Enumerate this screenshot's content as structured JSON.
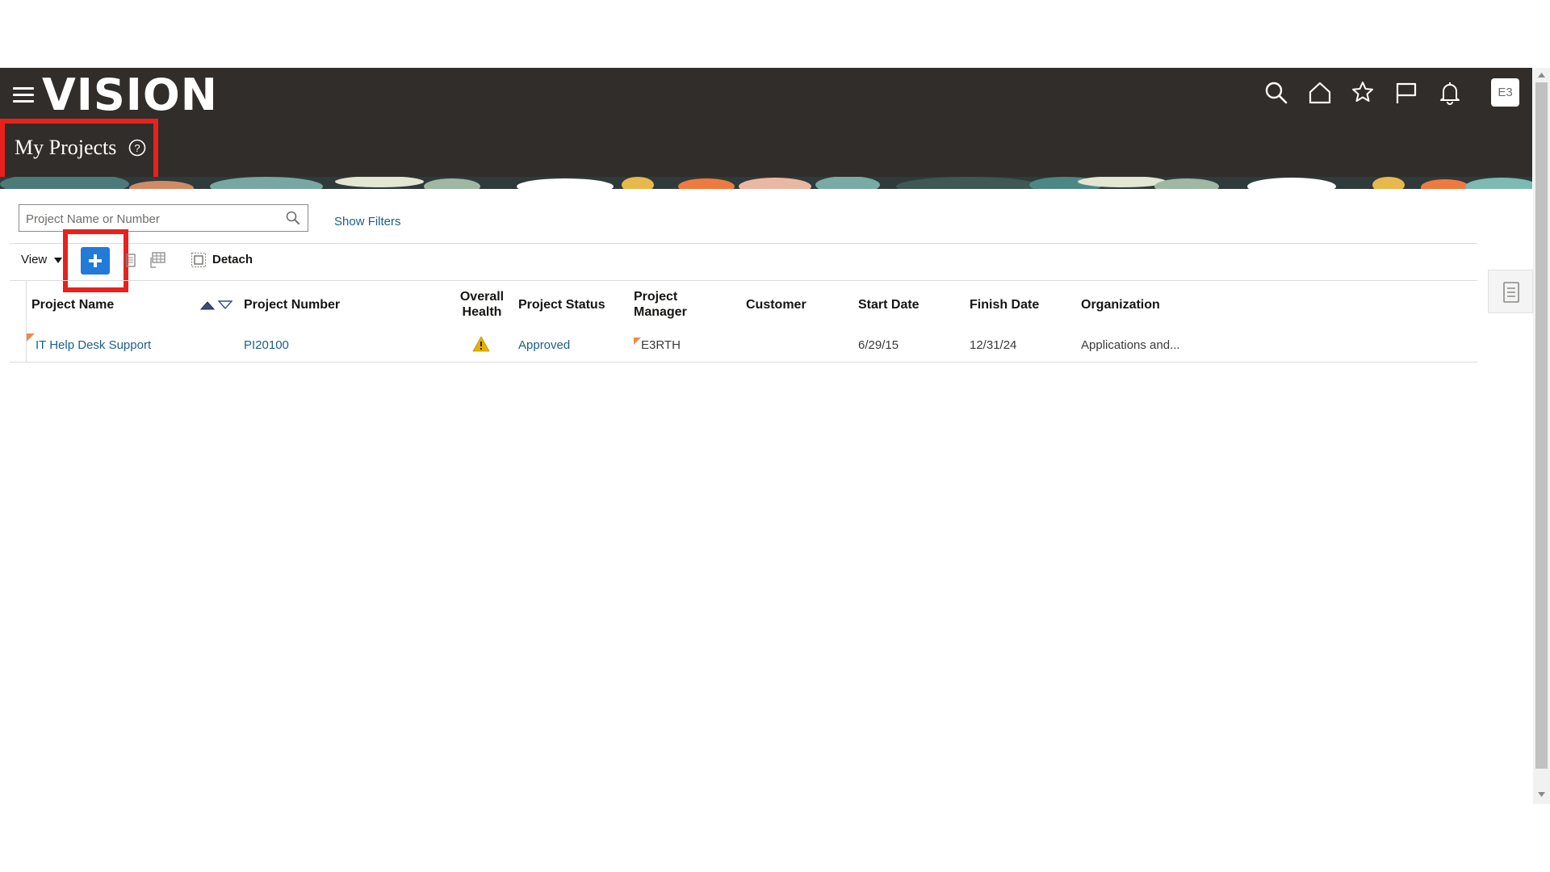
{
  "header": {
    "app_name": "VISION",
    "page_title": "My Projects",
    "user_initials": "E3",
    "icons": [
      "hamburger-menu-icon",
      "search-icon",
      "home-icon",
      "favorites-star-icon",
      "flag-icon",
      "notifications-bell-icon",
      "help-icon"
    ]
  },
  "search": {
    "placeholder": "Project Name or Number",
    "value": "",
    "show_filters_label": "Show Filters"
  },
  "toolbar": {
    "view_label": "View",
    "detach_label": "Detach",
    "icons": [
      "create-plus-icon",
      "export-icon",
      "freeze-columns-icon",
      "detach-icon"
    ]
  },
  "table": {
    "columns": [
      "Project Name",
      "Project Number",
      "Overall Health",
      "Project Status",
      "Project Manager",
      "Customer",
      "Start Date",
      "Finish Date",
      "Organization"
    ],
    "rows": [
      {
        "project_name": "IT Help Desk Support",
        "project_number": "PI20100",
        "overall_health": "warning",
        "project_status": "Approved",
        "project_manager": "E3RTH",
        "customer": "",
        "start_date": "6/29/15",
        "finish_date": "12/31/24",
        "organization": "Applications and..."
      }
    ]
  },
  "colors": {
    "header_bg": "#312d2a",
    "link": "#1a5f8c",
    "primary_button": "#227ad9",
    "highlight": "#e8211c",
    "warning": "#e5b000"
  }
}
